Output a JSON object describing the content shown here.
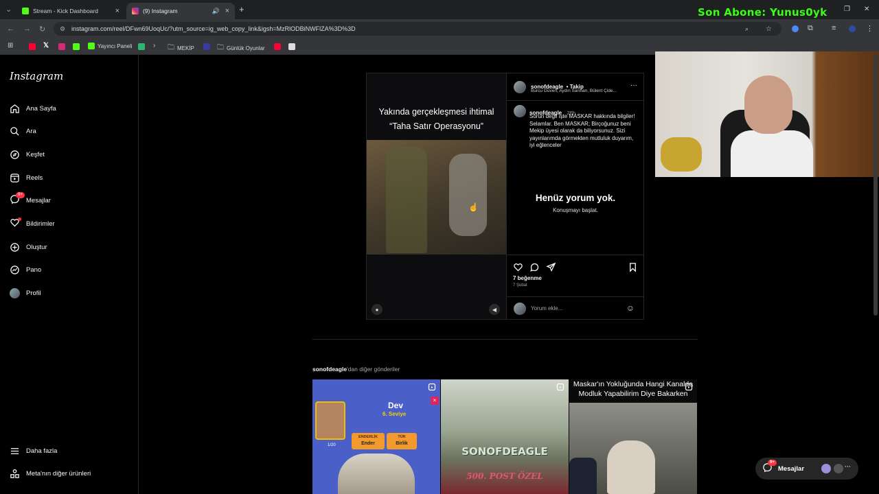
{
  "browser": {
    "tabs": [
      {
        "label": "Stream - Kick Dashboard",
        "favicon_color": "#53fc18"
      },
      {
        "label": "(9) Instagram",
        "favicon_color": "#d62976"
      }
    ],
    "url": "instagram.com/reel/DFwn69UoqUc/?utm_source=ig_web_copy_link&igsh=MzRlODBiNWFlZA%3D%3D",
    "bookmarks": [
      "Yayıncı Paneli",
      "MEKİP",
      "Günlük Oyunlar"
    ]
  },
  "overlay": {
    "subscriber_banner": "Son Abone: Yunus0yk"
  },
  "sidebar": {
    "logo": "Instagram",
    "items": [
      {
        "label": "Ana Sayfa",
        "icon": "home-icon"
      },
      {
        "label": "Ara",
        "icon": "search-icon"
      },
      {
        "label": "Keşfet",
        "icon": "compass-icon"
      },
      {
        "label": "Reels",
        "icon": "reels-icon"
      },
      {
        "label": "Mesajlar",
        "icon": "messenger-icon",
        "badge": "9+"
      },
      {
        "label": "Bildirimler",
        "icon": "heart-icon"
      },
      {
        "label": "Oluştur",
        "icon": "plus-icon"
      },
      {
        "label": "Pano",
        "icon": "dashboard-icon"
      },
      {
        "label": "Profil",
        "icon": "avatar"
      }
    ],
    "bottom": [
      {
        "label": "Daha fazla",
        "icon": "menu-icon"
      },
      {
        "label": "Meta'nın diğer ürünleri",
        "icon": "grid-icon"
      }
    ]
  },
  "post": {
    "video_caption_line1": "Yakında gerçekleşmesi ihtimal",
    "video_caption_line2": "“Taha Satır Operasyonu”",
    "author": "sonofdeagle",
    "follow": "• Takip",
    "collaborators": "Burcu Güven, Aydın Sarman, Bülent Çide...",
    "comment_author": "sonofdeagle",
    "comment_time": "26h",
    "comment_text": "Sorun değil işte MASKAR hakkında bilgiler! Selamlar. Ben MASKAR; Birçoğunuz beni Mekip üyesi olarak da biliyorsunuz. Sizi yayınlarımda görmekten mutluluk duyarım, iyi eğlenceler",
    "no_comments_title": "Henüz yorum yok.",
    "no_comments_sub": "Konuşmayı başlat.",
    "likes": "7 beğenme",
    "date": "7 Şubat",
    "comment_placeholder": "Yorum ekle..."
  },
  "more_posts": {
    "author": "sonofdeagle",
    "suffix": "'dan diğer gönderiler",
    "thumbs": [
      {
        "title": "Dev",
        "subtitle": "6. Seviye",
        "tag1": "ENDERLİK",
        "tag1_val": "Ender",
        "tag2": "TÜR",
        "tag2_val": "Birlik",
        "count": "1/20"
      },
      {
        "title": "SONOFDEAGLE",
        "subtitle": "500. POST ÖZEL"
      },
      {
        "title": "Maskar'ın Yokluğunda Hangi Kanalda Modluk Yapabilirim Diye Bakarken"
      }
    ]
  },
  "chat_pill": {
    "label": "Mesajlar",
    "badge": "9+"
  }
}
